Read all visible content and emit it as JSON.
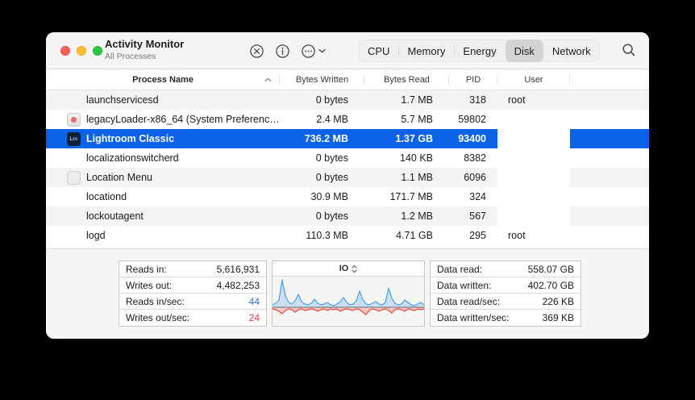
{
  "window": {
    "title": "Activity Monitor",
    "subtitle": "All Processes",
    "tabs": [
      "CPU",
      "Memory",
      "Energy",
      "Disk",
      "Network"
    ],
    "selected_tab": "Disk"
  },
  "toolbar": {
    "icons": [
      "stop-process-icon",
      "inspect-process-icon",
      "ellipsis-circle-icon",
      "chevron-down-icon",
      "search-icon"
    ]
  },
  "table": {
    "columns": [
      {
        "label": "Process Name",
        "sort": "ascending"
      },
      {
        "label": "Bytes Written"
      },
      {
        "label": "Bytes Read"
      },
      {
        "label": "PID"
      },
      {
        "label": "User"
      }
    ],
    "rows": [
      {
        "name": "launchservicesd",
        "icon": "",
        "icon_label": "",
        "bytes_written": "0 bytes",
        "bytes_read": "1.7 MB",
        "pid": "318",
        "user": "root",
        "selected": false
      },
      {
        "name": "legacyLoader-x86_64 (System Preferenc…",
        "icon": "legacy-app-icon",
        "icon_label": "",
        "bytes_written": "2.4 MB",
        "bytes_read": "5.7 MB",
        "pid": "59802",
        "user": "",
        "selected": false
      },
      {
        "name": "Lightroom Classic",
        "icon": "lightroom-app-icon",
        "icon_label": "Lrc",
        "bytes_written": "736.2 MB",
        "bytes_read": "1.37 GB",
        "pid": "93400",
        "user": "",
        "selected": true
      },
      {
        "name": "localizationswitcherd",
        "icon": "",
        "icon_label": "",
        "bytes_written": "0 bytes",
        "bytes_read": "140 KB",
        "pid": "8382",
        "user": "",
        "selected": false
      },
      {
        "name": "Location Menu",
        "icon": "generic-app-icon",
        "icon_label": "",
        "bytes_written": "0 bytes",
        "bytes_read": "1.1 MB",
        "pid": "6096",
        "user": "",
        "selected": false
      },
      {
        "name": "locationd",
        "icon": "",
        "icon_label": "",
        "bytes_written": "30.9 MB",
        "bytes_read": "171.7 MB",
        "pid": "324",
        "user": "",
        "selected": false
      },
      {
        "name": "lockoutagent",
        "icon": "",
        "icon_label": "",
        "bytes_written": "0 bytes",
        "bytes_read": "1.2 MB",
        "pid": "567",
        "user": "",
        "selected": false
      },
      {
        "name": "logd",
        "icon": "",
        "icon_label": "",
        "bytes_written": "110.3 MB",
        "bytes_read": "4.71 GB",
        "pid": "295",
        "user": "root",
        "selected": false
      }
    ]
  },
  "stats_left": {
    "rows": [
      {
        "label": "Reads in:",
        "value": "5,616,931",
        "color": "default"
      },
      {
        "label": "Writes out:",
        "value": "4,482,253",
        "color": "default"
      },
      {
        "label": "Reads in/sec:",
        "value": "44",
        "color": "blue"
      },
      {
        "label": "Writes out/sec:",
        "value": "24",
        "color": "red"
      }
    ]
  },
  "stats_right": {
    "rows": [
      {
        "label": "Data read:",
        "value": "558.07 GB"
      },
      {
        "label": "Data written:",
        "value": "402.70 GB"
      },
      {
        "label": "Data read/sec:",
        "value": "226 KB"
      },
      {
        "label": "Data written/sec:",
        "value": "369 KB"
      }
    ]
  },
  "chart_data": {
    "type": "area",
    "title": "IO",
    "xlabel": "",
    "ylabel": "",
    "baseline": 0,
    "legend_position": "none",
    "grid": false,
    "series": [
      {
        "name": "reads in/sec",
        "color": "#4aa0e8",
        "values": [
          3,
          5,
          9,
          34,
          14,
          6,
          4,
          8,
          16,
          7,
          4,
          3,
          5,
          10,
          5,
          3,
          4,
          6,
          3,
          2,
          4,
          7,
          12,
          6,
          3,
          4,
          8,
          20,
          9,
          4,
          3,
          5,
          7,
          4,
          3,
          6,
          24,
          11,
          5,
          3,
          4,
          9,
          6,
          3,
          2,
          4,
          6,
          3
        ]
      },
      {
        "name": "writes out/sec",
        "color": "#e8463c",
        "values": [
          -2,
          -3,
          -5,
          -8,
          -4,
          -2,
          -3,
          -6,
          -3,
          -2,
          -4,
          -3,
          -2,
          -3,
          -5,
          -3,
          -2,
          -4,
          -2,
          -3,
          -2,
          -5,
          -3,
          -2,
          -3,
          -4,
          -2,
          -3,
          -6,
          -9,
          -4,
          -2,
          -3,
          -5,
          -3,
          -2,
          -4,
          -7,
          -3,
          -2,
          -3,
          -5,
          -2,
          -3,
          -4,
          -2,
          -3,
          -2
        ]
      }
    ]
  },
  "colors": {
    "accent_blue": "#0c63e8",
    "value_blue": "#2e6be6",
    "value_red": "#e0383e",
    "row_alt": "#f4f3f3",
    "traffic_red": "#ff5f57",
    "traffic_yellow": "#febc2e",
    "traffic_green": "#28c840"
  }
}
